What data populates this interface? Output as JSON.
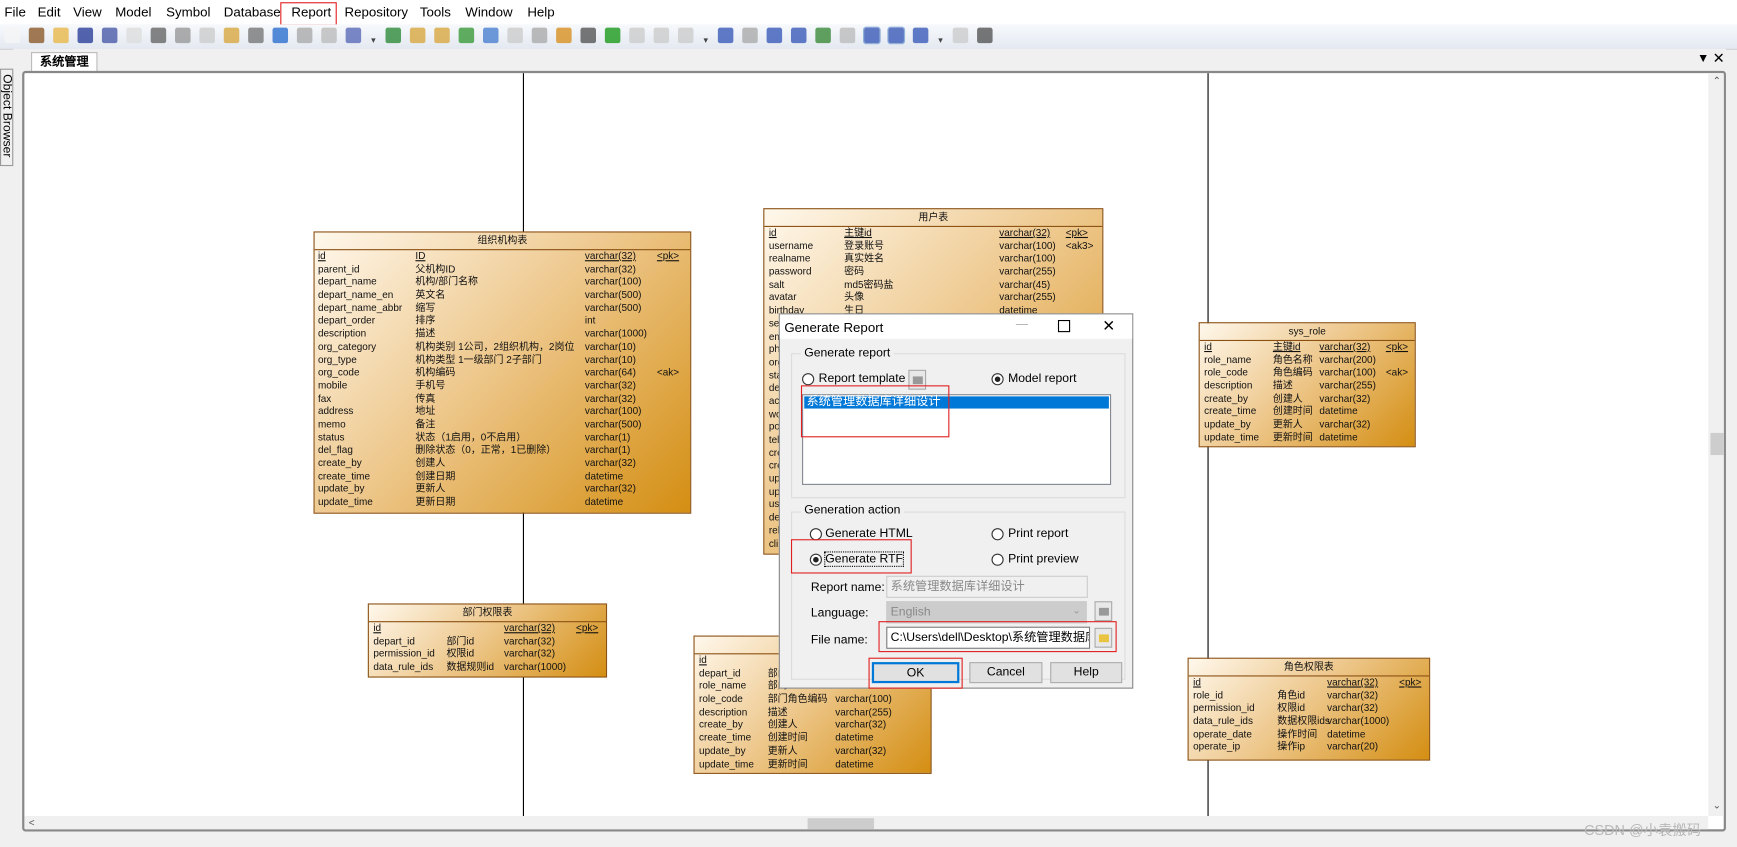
{
  "menu": [
    "File",
    "Edit",
    "View",
    "Model",
    "Symbol",
    "Database",
    "Report",
    "Repository",
    "Tools",
    "Window",
    "Help"
  ],
  "highlighted_menu": "Report",
  "toolbar_icons": [
    "new-icon",
    "new-model-icon",
    "open-icon",
    "save-icon",
    "save-all-icon",
    "print-preview-icon",
    "print-icon",
    "cut-icon",
    "copy-icon",
    "paste-icon",
    "delete-icon",
    "undo-icon",
    "redo-icon",
    "properties-icon",
    "help-icon",
    "new-package-icon",
    "paste-shortcut-icon",
    "find-icon",
    "refresh-icon",
    "check-model-icon",
    "shadow-icon",
    "align-icon",
    "pen-icon",
    "fill-icon",
    "font-icon",
    "export-icon",
    "back-icon",
    "forward-icon",
    "diagram-icon",
    "diagram2-icon",
    "page-icon",
    "pages-icon",
    "generate-icon",
    "disabled-icon",
    "zoom-icon",
    "list-icon",
    "table-icon",
    "preview-icon",
    "printer-icon"
  ],
  "tab": "系统管理",
  "object_browser": "Object Browser",
  "watermark": "CSDN @小袁搬码",
  "tables": [
    {
      "title": "组织机构表",
      "rows": [
        [
          "id",
          "ID",
          "varchar(32)",
          "<pk>"
        ],
        [
          "parent_id",
          "父机构ID",
          "varchar(32)",
          ""
        ],
        [
          "depart_name",
          "机构/部门名称",
          "varchar(100)",
          ""
        ],
        [
          "depart_name_en",
          "英文名",
          "varchar(500)",
          ""
        ],
        [
          "depart_name_abbr",
          "缩写",
          "varchar(500)",
          ""
        ],
        [
          "depart_order",
          "排序",
          "int",
          ""
        ],
        [
          "description",
          "描述",
          "varchar(1000)",
          ""
        ],
        [
          "org_category",
          "机构类别 1公司，2组织机构，2岗位",
          "varchar(10)",
          ""
        ],
        [
          "org_type",
          "机构类型 1一级部门 2子部门",
          "varchar(10)",
          ""
        ],
        [
          "org_code",
          "机构编码",
          "varchar(64)",
          "<ak>"
        ],
        [
          "mobile",
          "手机号",
          "varchar(32)",
          ""
        ],
        [
          "fax",
          "传真",
          "varchar(32)",
          ""
        ],
        [
          "address",
          "地址",
          "varchar(100)",
          ""
        ],
        [
          "memo",
          "备注",
          "varchar(500)",
          ""
        ],
        [
          "status",
          "状态（1启用，0不启用）",
          "varchar(1)",
          ""
        ],
        [
          "del_flag",
          "删除状态（0，正常，1已删除）",
          "varchar(1)",
          ""
        ],
        [
          "create_by",
          "创建人",
          "varchar(32)",
          ""
        ],
        [
          "create_time",
          "创建日期",
          "datetime",
          ""
        ],
        [
          "update_by",
          "更新人",
          "varchar(32)",
          ""
        ],
        [
          "update_time",
          "更新日期",
          "datetime",
          ""
        ]
      ]
    },
    {
      "title": "用户表",
      "rows": [
        [
          "id",
          "主键id",
          "varchar(32)",
          "<pk>"
        ],
        [
          "username",
          "登录账号",
          "varchar(100)",
          "<ak3>"
        ],
        [
          "realname",
          "真实姓名",
          "varchar(100)",
          ""
        ],
        [
          "password",
          "密码",
          "varchar(255)",
          ""
        ],
        [
          "salt",
          "md5密码盐",
          "varchar(45)",
          ""
        ],
        [
          "avatar",
          "头像",
          "varchar(255)",
          ""
        ],
        [
          "birthday",
          "生日",
          "datetime",
          ""
        ],
        [
          "sex",
          "",
          "",
          ""
        ],
        [
          "em",
          "",
          "",
          ""
        ],
        [
          "ph",
          "",
          "",
          ""
        ],
        [
          "org",
          "",
          "",
          ""
        ],
        [
          "sta",
          "",
          "",
          ""
        ],
        [
          "de",
          "",
          "",
          ""
        ],
        [
          "ac",
          "",
          "",
          ""
        ],
        [
          "wo",
          "",
          "",
          ""
        ],
        [
          "po",
          "",
          "",
          ""
        ],
        [
          "tel",
          "",
          "",
          ""
        ],
        [
          "cre",
          "",
          "",
          ""
        ],
        [
          "cre",
          "",
          "",
          ""
        ],
        [
          "up",
          "",
          "",
          ""
        ],
        [
          "up",
          "",
          "",
          ""
        ],
        [
          "use",
          "",
          "",
          ""
        ],
        [
          "de",
          "",
          "",
          ""
        ],
        [
          "rel",
          "",
          "",
          ""
        ],
        [
          "cli",
          "",
          "",
          ""
        ]
      ]
    },
    {
      "title": "sys_role",
      "rows": [
        [
          "id",
          "主键id",
          "varchar(32)",
          "<pk>"
        ],
        [
          "role_name",
          "角色名称",
          "varchar(200)",
          ""
        ],
        [
          "role_code",
          "角色编码",
          "varchar(100)",
          "<ak>"
        ],
        [
          "description",
          "描述",
          "varchar(255)",
          ""
        ],
        [
          "create_by",
          "创建人",
          "varchar(32)",
          ""
        ],
        [
          "create_time",
          "创建时间",
          "datetime",
          ""
        ],
        [
          "update_by",
          "更新人",
          "varchar(32)",
          ""
        ],
        [
          "update_time",
          "更新时间",
          "datetime",
          ""
        ]
      ]
    },
    {
      "title": "部门权限表",
      "rows": [
        [
          "id",
          "",
          "varchar(32)",
          "<pk>"
        ],
        [
          "depart_id",
          "部门id",
          "varchar(32)",
          ""
        ],
        [
          "permission_id",
          "权限id",
          "varchar(32)",
          ""
        ],
        [
          "data_rule_ids",
          "数据规则id",
          "varchar(1000)",
          ""
        ]
      ]
    },
    {
      "title": "",
      "rows": [
        [
          "id",
          "",
          "",
          ""
        ],
        [
          "depart_id",
          "部门",
          "",
          ""
        ],
        [
          "role_name",
          "部门",
          "",
          ""
        ],
        [
          "role_code",
          "部门角色编码",
          "varchar(100)",
          ""
        ],
        [
          "description",
          "描述",
          "varchar(255)",
          ""
        ],
        [
          "create_by",
          "创建人",
          "varchar(32)",
          ""
        ],
        [
          "create_time",
          "创建时间",
          "datetime",
          ""
        ],
        [
          "update_by",
          "更新人",
          "varchar(32)",
          ""
        ],
        [
          "update_time",
          "更新时间",
          "datetime",
          ""
        ]
      ]
    },
    {
      "title": "角色权限表",
      "rows": [
        [
          "id",
          "",
          "varchar(32)",
          "<pk>"
        ],
        [
          "role_id",
          "角色id",
          "varchar(32)",
          ""
        ],
        [
          "permission_id",
          "权限id",
          "varchar(32)",
          ""
        ],
        [
          "data_rule_ids",
          "数据权限ids",
          "varchar(1000)",
          ""
        ],
        [
          "operate_date",
          "操作时间",
          "datetime",
          ""
        ],
        [
          "operate_ip",
          "操作ip",
          "varchar(20)",
          ""
        ]
      ]
    }
  ],
  "dialog": {
    "title": "Generate Report",
    "group_report": "Generate report",
    "report_template": "Report template",
    "model_report": "Model report",
    "report_type_selected": "Model report",
    "report_list": [
      "系统管理数据库详细设计"
    ],
    "group_action": "Generation action",
    "generate_html": "Generate HTML",
    "generate_rtf": "Generate RTF",
    "print_report": "Print report",
    "print_preview": "Print preview",
    "action_selected": "Generate RTF",
    "report_name_label": "Report name:",
    "report_name": "系统管理数据库详细设计",
    "language_label": "Language:",
    "language": "English",
    "file_name_label": "File name:",
    "file_name": "C:\\Users\\dell\\Desktop\\系统管理数据库",
    "ok": "OK",
    "cancel": "Cancel",
    "help": "Help"
  },
  "colors": {
    "highlight_box": "#e02020",
    "selection": "#0078d7",
    "table_dark": "#d48e12",
    "table_light": "#fff8ec"
  }
}
